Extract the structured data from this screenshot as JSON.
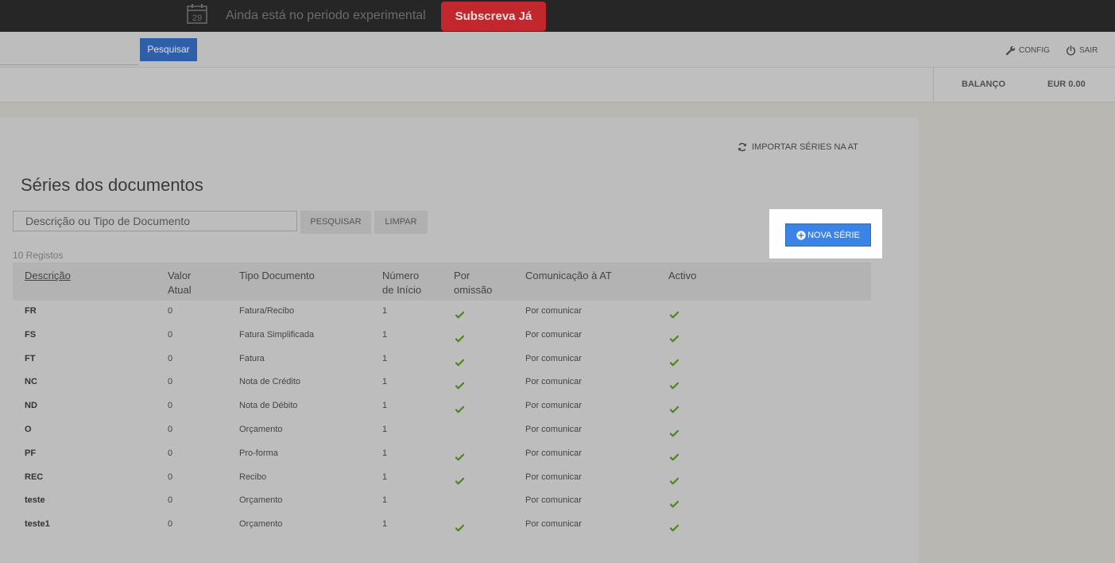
{
  "trial": {
    "calendar_day": "29",
    "message": "Ainda está no periodo experimental",
    "subscribe_label": "Subscreva Já"
  },
  "nav": {
    "search_button": "Pesquisar",
    "config_label": "CONFIG",
    "logout_label": "SAIR"
  },
  "balance": {
    "label": "BALANÇO",
    "value": "EUR 0.00"
  },
  "page": {
    "import_label": "IMPORTAR SÉRIES NA AT",
    "title": "Séries dos documentos",
    "search_placeholder": "Descrição ou Tipo de Documento",
    "search_button": "PESQUISAR",
    "clear_button": "LIMPAR",
    "new_series_button": "NOVA SÉRIE",
    "record_count": "10 Registos"
  },
  "table": {
    "headers": {
      "description": "Descrição",
      "current_value_1": "Valor",
      "current_value_2": "Atual",
      "doc_type": "Tipo Documento",
      "start_number_1": "Número",
      "start_number_2": "de Início",
      "default_1": "Por",
      "default_2": "omissão",
      "at_comm": "Comunicação à AT",
      "active": "Activo"
    },
    "rows": [
      {
        "code": "FR",
        "value": "0",
        "type": "Fatura/Recibo",
        "start": "1",
        "default": true,
        "comm": "Por comunicar",
        "active": true
      },
      {
        "code": "FS",
        "value": "0",
        "type": "Fatura Simplificada",
        "start": "1",
        "default": true,
        "comm": "Por comunicar",
        "active": true
      },
      {
        "code": "FT",
        "value": "0",
        "type": "Fatura",
        "start": "1",
        "default": true,
        "comm": "Por comunicar",
        "active": true
      },
      {
        "code": "NC",
        "value": "0",
        "type": "Nota de Crédito",
        "start": "1",
        "default": true,
        "comm": "Por comunicar",
        "active": true
      },
      {
        "code": "ND",
        "value": "0",
        "type": "Nota de Débito",
        "start": "1",
        "default": true,
        "comm": "Por comunicar",
        "active": true
      },
      {
        "code": "O",
        "value": "0",
        "type": "Orçamento",
        "start": "1",
        "default": false,
        "comm": "Por comunicar",
        "active": true
      },
      {
        "code": "PF",
        "value": "0",
        "type": "Pro-forma",
        "start": "1",
        "default": true,
        "comm": "Por comunicar",
        "active": true
      },
      {
        "code": "REC",
        "value": "0",
        "type": "Recibo",
        "start": "1",
        "default": true,
        "comm": "Por comunicar",
        "active": true
      },
      {
        "code": "teste",
        "value": "0",
        "type": "Orçamento",
        "start": "1",
        "default": false,
        "comm": "Por comunicar",
        "active": true
      },
      {
        "code": "teste1",
        "value": "0",
        "type": "Orçamento",
        "start": "1",
        "default": true,
        "comm": "Por comunicar",
        "active": true
      }
    ]
  },
  "colors": {
    "subscribe": "#c1272d",
    "primary": "#3b83e6",
    "check": "#4a8a1c"
  }
}
